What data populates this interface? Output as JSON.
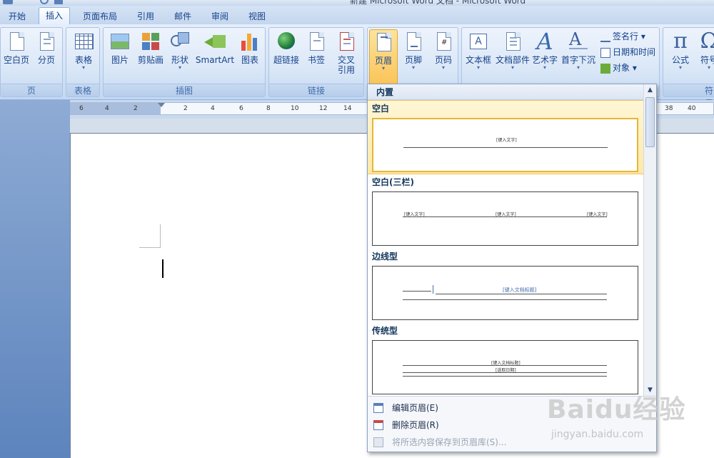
{
  "window": {
    "title": "新建 Microsoft Word 文档 - Microsoft Word"
  },
  "tabs": [
    {
      "label": "开始",
      "active": false
    },
    {
      "label": "插入",
      "active": true
    },
    {
      "label": "页面布局",
      "active": false
    },
    {
      "label": "引用",
      "active": false
    },
    {
      "label": "邮件",
      "active": false
    },
    {
      "label": "审阅",
      "active": false
    },
    {
      "label": "视图",
      "active": false
    }
  ],
  "ribbon": {
    "groups": {
      "pages": "页",
      "tables": "表格",
      "illustrations": "插图",
      "links": "链接",
      "headerfooter": "",
      "text": "",
      "symbols": "符号"
    },
    "buttons": {
      "blank_page": "空白页",
      "page_break": "分页",
      "table": "表格",
      "picture": "图片",
      "clipart": "剪贴画",
      "shapes": "形状",
      "smartart": "SmartArt",
      "chart": "图表",
      "hyperlink": "超链接",
      "bookmark": "书签",
      "cross_ref_1": "交叉",
      "cross_ref_2": "引用",
      "header": "页眉",
      "footer": "页脚",
      "page_number": "页码",
      "textbox": "文本框",
      "quick_parts": "文档部件",
      "wordart": "艺术字",
      "dropcap": "首字下沉",
      "signature": "签名行",
      "datetime": "日期和时间",
      "object": "对象",
      "equation": "公式",
      "symbol": "符号"
    }
  },
  "ruler": {
    "ticks": [
      "6",
      "4",
      "2",
      "2",
      "4",
      "6",
      "8",
      "10",
      "12",
      "14",
      "38",
      "40"
    ]
  },
  "dropdown": {
    "section_title": "内置",
    "headers": [
      {
        "name": "空白",
        "placeholders": [
          "[键入文字]"
        ]
      },
      {
        "name": "空白(三栏)",
        "placeholders": [
          "[键入文字]",
          "[键入文字]",
          "[键入文字]"
        ]
      },
      {
        "name": "边线型",
        "placeholders": [
          "[键入文档标题]"
        ]
      },
      {
        "name": "传统型",
        "placeholders": [
          "[键入文档标题]",
          "[选取日期]"
        ]
      }
    ],
    "menu": {
      "edit": "编辑页眉(E)",
      "remove": "删除页眉(R)",
      "save": "将所选内容保存到页眉库(S)..."
    }
  },
  "watermark": {
    "brand": "Baidu经验",
    "url": "jingyan.baidu.com"
  }
}
